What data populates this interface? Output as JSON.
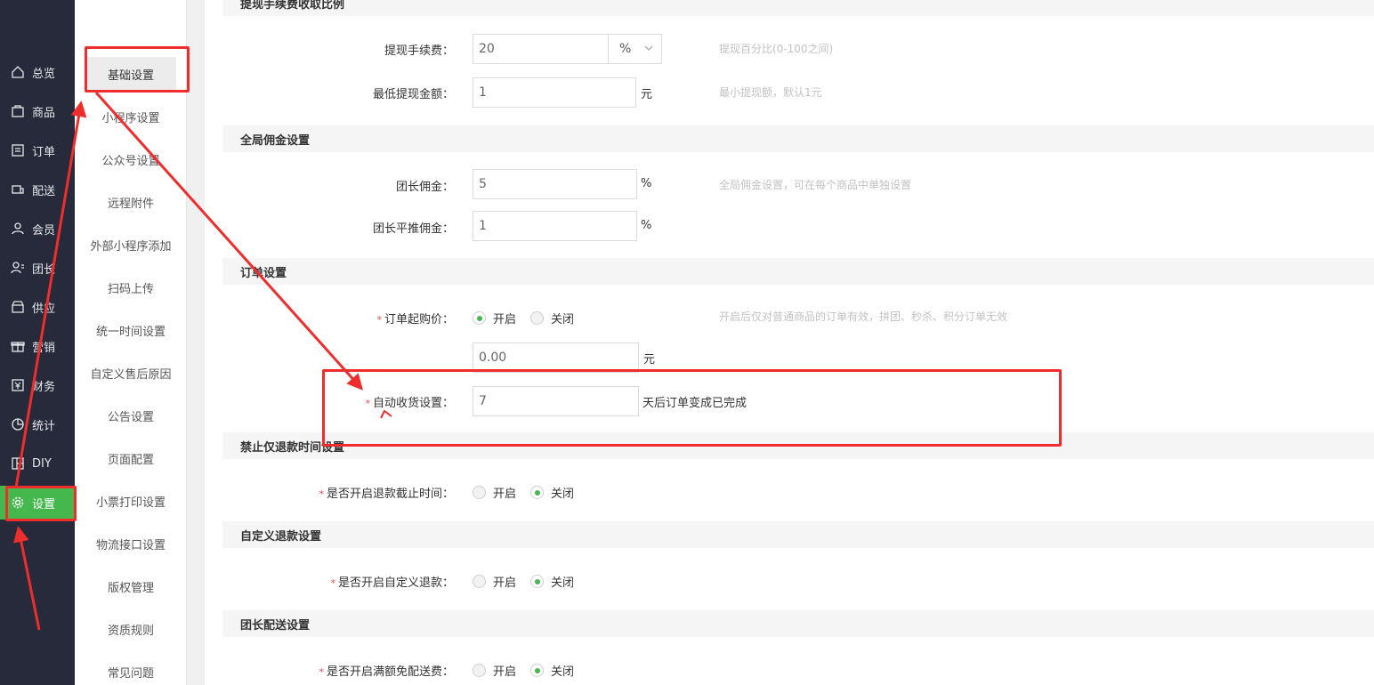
{
  "nav": {
    "items": [
      {
        "label": "总览",
        "icon": "home-icon"
      },
      {
        "label": "商品",
        "icon": "goods-icon"
      },
      {
        "label": "订单",
        "icon": "order-icon"
      },
      {
        "label": "配送",
        "icon": "delivery-icon"
      },
      {
        "label": "会员",
        "icon": "user-icon"
      },
      {
        "label": "团长",
        "icon": "group-leader-icon"
      },
      {
        "label": "供应",
        "icon": "supply-icon"
      },
      {
        "label": "营销",
        "icon": "gift-icon"
      },
      {
        "label": "财务",
        "icon": "finance-icon"
      },
      {
        "label": "统计",
        "icon": "pie-chart-icon"
      },
      {
        "label": "DIY",
        "icon": "diy-icon"
      },
      {
        "label": "设置",
        "icon": "gear-icon",
        "active": true
      }
    ]
  },
  "subnav": {
    "items": [
      "基础设置",
      "小程序设置",
      "公众号设置",
      "远程附件",
      "外部小程序添加",
      "扫码上传",
      "统一时间设置",
      "自定义售后原因",
      "公告设置",
      "页面配置",
      "小票打印设置",
      "物流接口设置",
      "版权管理",
      "资质规则",
      "常见问题"
    ],
    "active_index": 0
  },
  "sections": {
    "withdraw_title": "提现手续费收取比例",
    "commission_title": "全局佣金设置",
    "order_title": "订单设置",
    "refund_title": "禁止仅退款时间设置",
    "custom_refund_title": "自定义退款设置",
    "leader_delivery_title": "团长配送设置"
  },
  "withdraw": {
    "fee_label": "提现手续费：",
    "fee_value": "20",
    "fee_unit_select": "%",
    "fee_hint": "提现百分比(0-100之间)",
    "min_label": "最低提现金额：",
    "min_value": "1",
    "min_unit": "元",
    "min_hint": "最小提现额，默认1元"
  },
  "commission": {
    "leader_label": "团长佣金：",
    "leader_value": "5",
    "leader_unit": "%",
    "hint": "全局佣金设置，可在每个商品中单独设置",
    "push_label": "团长平推佣金：",
    "push_value": "1",
    "push_unit": "%"
  },
  "order": {
    "min_buy_label": "订单起购价：",
    "on_label": "开启",
    "off_label": "关闭",
    "min_buy_enabled": true,
    "min_buy_hint": "开启后仅对普通商品的订单有效，拼团、秒杀、积分订单无效",
    "min_buy_value": "0.00",
    "min_buy_unit": "元",
    "auto_receive_label": "自动收货设置：",
    "auto_receive_value": "7",
    "auto_receive_unit": "天后订单变成已完成"
  },
  "refund": {
    "deadline_label": "是否开启退款截止时间：",
    "deadline_enabled": false
  },
  "custom_refund": {
    "label": "是否开启自定义退款：",
    "enabled": false
  },
  "leader_delivery": {
    "label": "是否开启满额免配送费：",
    "enabled": false
  },
  "colors": {
    "accent": "#45b84d",
    "nav_bg": "#262a3a",
    "annotation": "#ef2d2d"
  }
}
